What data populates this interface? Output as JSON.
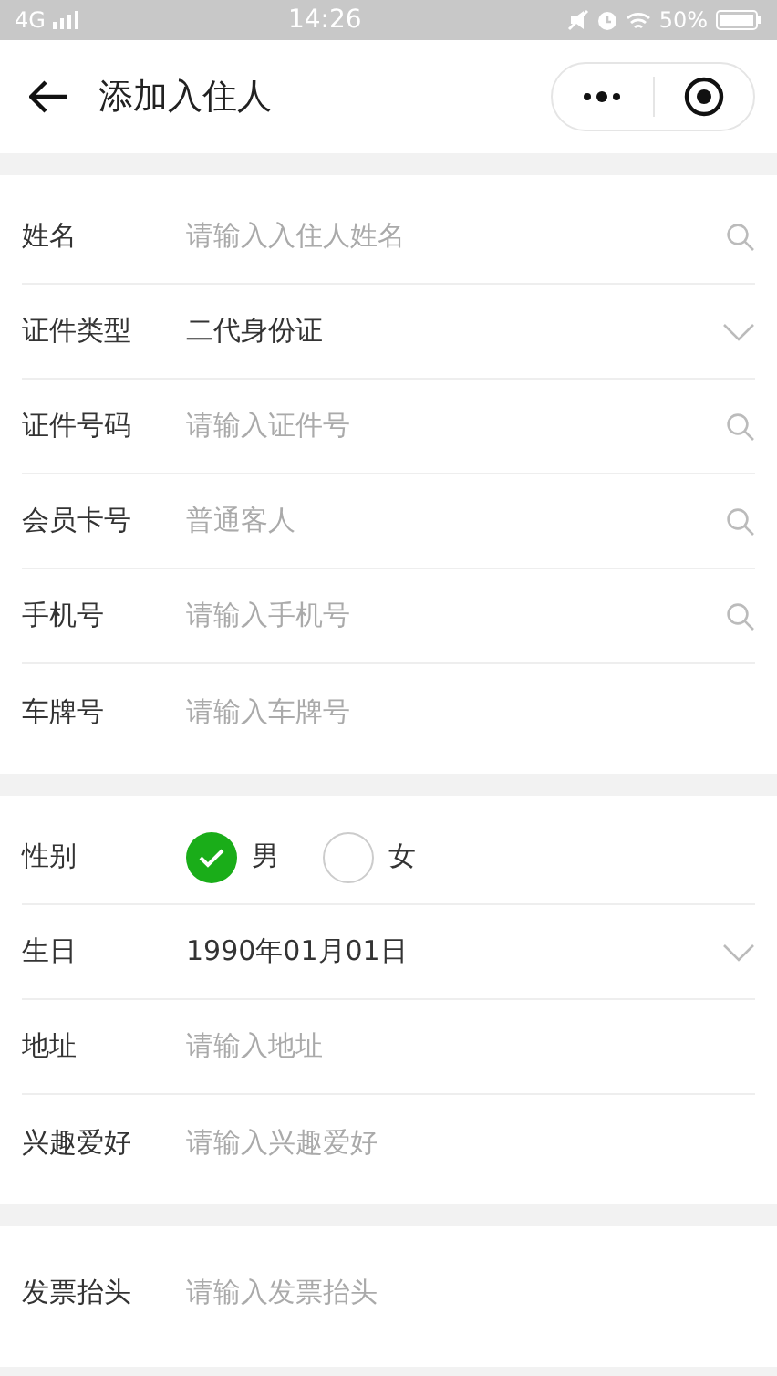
{
  "status_bar": {
    "network": "4G",
    "time": "14:26",
    "battery": "50%"
  },
  "nav": {
    "title": "添加入住人"
  },
  "sections": [
    {
      "rows": [
        {
          "kind": "search-input",
          "label": "姓名",
          "placeholder": "请输入入住人姓名"
        },
        {
          "kind": "select",
          "label": "证件类型",
          "value": "二代身份证"
        },
        {
          "kind": "search-input",
          "label": "证件号码",
          "placeholder": "请输入证件号"
        },
        {
          "kind": "search-input",
          "label": "会员卡号",
          "placeholder": "普通客人"
        },
        {
          "kind": "search-input",
          "label": "手机号",
          "placeholder": "请输入手机号"
        },
        {
          "kind": "input",
          "label": "车牌号",
          "placeholder": "请输入车牌号"
        }
      ]
    },
    {
      "rows": [
        {
          "kind": "radio",
          "label": "性别",
          "options": [
            {
              "label": "男",
              "selected": true
            },
            {
              "label": "女",
              "selected": false
            }
          ]
        },
        {
          "kind": "select",
          "label": "生日",
          "value": "1990年01月01日"
        },
        {
          "kind": "input",
          "label": "地址",
          "placeholder": "请输入地址"
        },
        {
          "kind": "input",
          "label": "兴趣爱好",
          "placeholder": "请输入兴趣爱好"
        }
      ]
    },
    {
      "rows": [
        {
          "kind": "input",
          "label": "发票抬头",
          "placeholder": "请输入发票抬头"
        }
      ]
    }
  ]
}
